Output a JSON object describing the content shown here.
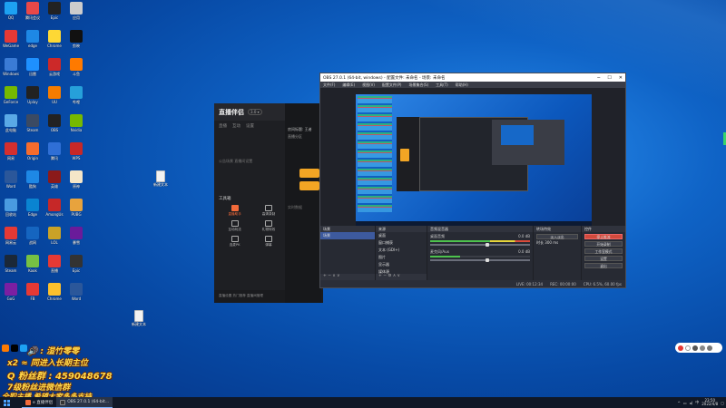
{
  "desktop": {
    "icons": [
      {
        "label": "QQ",
        "color": "#1da1f2"
      },
      {
        "label": "腾讯会议",
        "color": "#e94848"
      },
      {
        "label": "Epic",
        "color": "#222"
      },
      {
        "label": "应用",
        "color": "#ccc"
      },
      {
        "label": "WeGame",
        "color": "#e53935"
      },
      {
        "label": "edge",
        "color": "#1e88e5"
      },
      {
        "label": "Chrome",
        "color": "#fdd835"
      },
      {
        "label": "剪映",
        "color": "#111"
      },
      {
        "label": "Windows",
        "color": "#3a7bd5"
      },
      {
        "label": "迅雷",
        "color": "#1e90ff"
      },
      {
        "label": "云游戏",
        "color": "#cc2929"
      },
      {
        "label": "斗鱼",
        "color": "#ff7a00"
      },
      {
        "label": "GeForce",
        "color": "#76b900"
      },
      {
        "label": "Uplay",
        "color": "#222"
      },
      {
        "label": "UU",
        "color": "#f57c00"
      },
      {
        "label": "哔哩",
        "color": "#26a0da"
      },
      {
        "label": "此电脑",
        "color": "#5aa9e6"
      },
      {
        "label": "Steam",
        "color": "#3b4a63"
      },
      {
        "label": "OBS",
        "color": "#222"
      },
      {
        "label": "Nvidia",
        "color": "#76b900"
      },
      {
        "label": "网易",
        "color": "#d32f2f"
      },
      {
        "label": "Origin",
        "color": "#f56c2d"
      },
      {
        "label": "腾讯",
        "color": "#2f6fd6"
      },
      {
        "label": "WPS",
        "color": "#c62828"
      },
      {
        "label": "Word",
        "color": "#2b579a"
      },
      {
        "label": "酷狗",
        "color": "#1e88e5"
      },
      {
        "label": "英雄",
        "color": "#8b1a1a"
      },
      {
        "label": "原神",
        "color": "#f5e6c8"
      },
      {
        "label": "回收站",
        "color": "#4a9be0"
      },
      {
        "label": "Edge",
        "color": "#0a84d1"
      },
      {
        "label": "AmongUs",
        "color": "#c62828"
      },
      {
        "label": "PUBG",
        "color": "#e8a33d"
      },
      {
        "label": "网易云",
        "color": "#e53935"
      },
      {
        "label": "战网",
        "color": "#1565c0"
      },
      {
        "label": "LOL",
        "color": "#c9a227"
      },
      {
        "label": "暴雪",
        "color": "#6a1b9a"
      },
      {
        "label": "Steam",
        "color": "#1b2838"
      },
      {
        "label": "Kook",
        "color": "#76c043"
      },
      {
        "label": "直播",
        "color": "#e53935"
      },
      {
        "label": "Epic",
        "color": "#333"
      },
      {
        "label": "GoG",
        "color": "#7b1fa2"
      },
      {
        "label": "FB",
        "color": "#e53935"
      },
      {
        "label": "Chrome",
        "color": "#fbc02d"
      },
      {
        "label": "Word",
        "color": "#2b579a"
      }
    ],
    "files": [
      {
        "label": "新建文本"
      },
      {
        "label": "新建文本"
      }
    ]
  },
  "live_app": {
    "logo": "直播伴侣",
    "version": "3.0 ▾",
    "tabs": [
      "直播",
      "互动",
      "设置"
    ],
    "hint": "公告场景  直播间设置",
    "tool_title": "工具箱",
    "tools": [
      "直播助手",
      "高清录制",
      "直播公告",
      "互动玩法",
      "礼物特效",
      "粉丝团",
      "连麦PK",
      "弹幕",
      "更多"
    ],
    "footer": "直播设置  热门推荐  直播间管理",
    "right_title": "房间标题: 王者",
    "right_sub": "直播分区",
    "right_note": "实时数据"
  },
  "obs": {
    "title": "OBS 27.0.1 (64-bit, windows) - 配置文件: 未命名 - 场景: 未命名",
    "window_controls": [
      "─",
      "☐",
      "✕"
    ],
    "menu": [
      "文件(F)",
      "编辑(E)",
      "视图(V)",
      "配置文件(P)",
      "场景集合(S)",
      "工具(T)",
      "帮助(H)"
    ],
    "docks": {
      "scenes": {
        "header": "场景",
        "items": [
          "场景"
        ]
      },
      "sources": {
        "header": "来源",
        "items": [
          "桌面",
          "窗口捕获",
          "文本 (GDI+)",
          "图片",
          "显示器",
          "媒体源",
          "Source"
        ]
      },
      "mixer": {
        "header": "音频混音器",
        "channels": [
          {
            "name": "桌面音频",
            "db": "0.0 dB"
          },
          {
            "name": "麦克风/Aux",
            "db": "0.0 dB"
          }
        ]
      },
      "transitions": {
        "header": "转场特效",
        "type": "淡入淡出",
        "duration_label": "时长",
        "duration": "300 ms"
      },
      "controls": {
        "header": "控件",
        "buttons": [
          "停止推流",
          "开始录制",
          "工作室模式",
          "设置",
          "退出"
        ]
      }
    },
    "status": {
      "live": "LIVE: 00:12:34",
      "rec": "REC: 00:00:00",
      "cpu": "CPU: 6.5%, 60.00 fps"
    }
  },
  "overlay": {
    "line1": "🔊 : 湿竹零零",
    "line2": "x2 ≈ 同进入长期主位",
    "line3": "Q 粉丝群 : 459048678",
    "line4": "7级粉丝进微信群",
    "line5": "全职主播 希望大家多多支持"
  },
  "taskbar": {
    "apps": [
      {
        "label": "e 直播伴侣",
        "color": "#f26a3a",
        "active": false
      },
      {
        "label": "OBS 27.0.1 (64-bit...",
        "color": "#333",
        "active": true
      }
    ],
    "time": "23:50",
    "date": "2022/4/8"
  }
}
